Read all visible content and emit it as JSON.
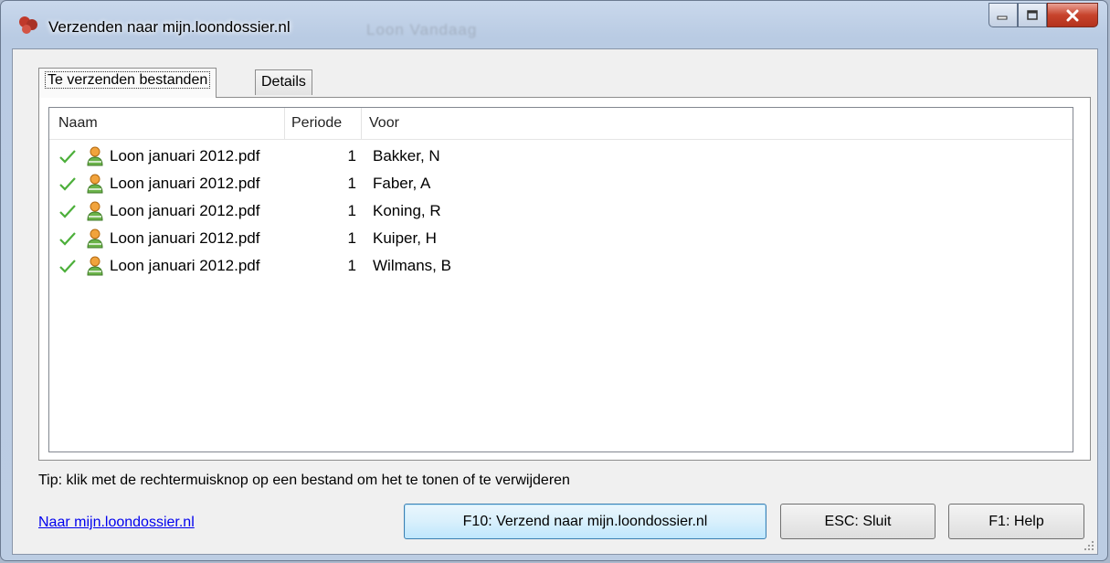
{
  "window": {
    "title": "Verzenden naar mijn.loondossier.nl",
    "background_ghost_text": "Loon Vandaag"
  },
  "tabs": [
    {
      "label": "Te verzenden bestanden"
    },
    {
      "label": "Details"
    }
  ],
  "table": {
    "columns": [
      "Naam",
      "Periode",
      "Voor"
    ],
    "rows": [
      {
        "naam": "Loon januari 2012.pdf",
        "periode": "1",
        "voor": "Bakker, N"
      },
      {
        "naam": "Loon januari 2012.pdf",
        "periode": "1",
        "voor": "Faber, A"
      },
      {
        "naam": "Loon januari 2012.pdf",
        "periode": "1",
        "voor": "Koning, R"
      },
      {
        "naam": "Loon januari 2012.pdf",
        "periode": "1",
        "voor": "Kuiper, H"
      },
      {
        "naam": "Loon januari 2012.pdf",
        "periode": "1",
        "voor": "Wilmans, B"
      }
    ]
  },
  "tip": "Tip: klik met de rechtermuisknop op een bestand om het te tonen of te verwijderen",
  "footer": {
    "link": "Naar mijn.loondossier.nl",
    "send_button": "F10: Verzend naar mijn.loondossier.nl",
    "close_button": "ESC: Sluit",
    "help_button": "F1: Help"
  },
  "icons": {
    "check": "check-icon",
    "user": "user-icon",
    "app": "app-icon"
  },
  "colors": {
    "check": "#4caf3a",
    "link": "#0000ee",
    "close_button": "#c7432c"
  }
}
